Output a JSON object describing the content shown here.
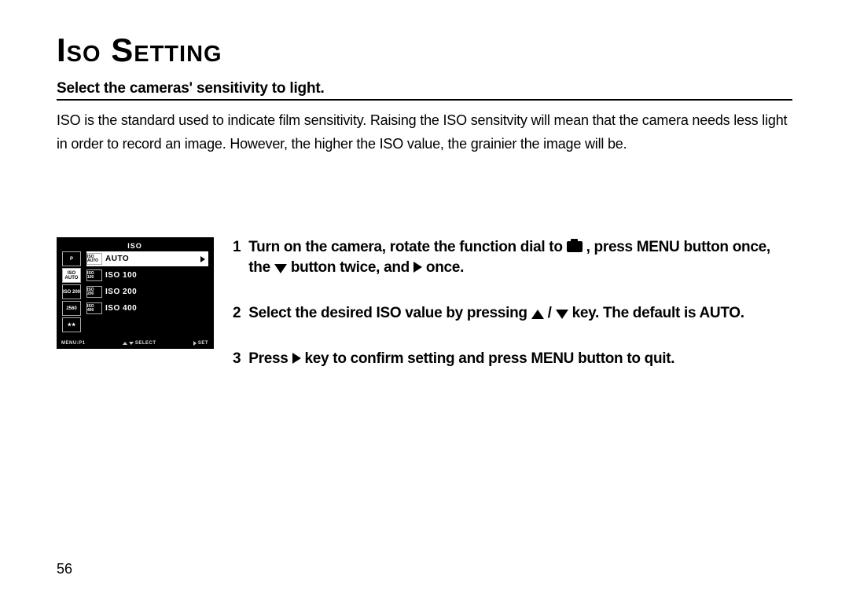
{
  "title": "Iso Setting",
  "subhead": "Select the cameras' sensitivity to light.",
  "paragraph": "ISO is the standard used to indicate film sensitivity. Raising the ISO sensitvity will mean that the camera needs less light in order to record an image. However, the higher the ISO value, the grainier the image will be.",
  "lcd": {
    "title": "ISO",
    "left_icons": [
      "P",
      "ISO\nAUTO",
      "ISO\n200",
      "2560",
      "★★"
    ],
    "rows": [
      {
        "icon": "ISO\nAUTO",
        "label": "AUTO",
        "highlight": true
      },
      {
        "icon": "ISO\n100",
        "label": "ISO 100"
      },
      {
        "icon": "ISO\n200",
        "label": "ISO 200"
      },
      {
        "icon": "ISO\n400",
        "label": "ISO 400"
      }
    ],
    "footer": {
      "left": "MENU:P1",
      "mid": "SELECT",
      "right": "SET"
    }
  },
  "steps": [
    {
      "n": "1",
      "pre": "Turn on the camera, rotate the function dial to ",
      "mid": " , press MENU button once, the  ",
      "post": " button twice, and ",
      "end": " once."
    },
    {
      "n": "2",
      "pre": "Select the desired ISO value by pressing ",
      "mid2": " / ",
      "post": "  key. The default is AUTO."
    },
    {
      "n": "3",
      "pre": "Press  ",
      "post": "  key to confirm setting and press MENU button to quit."
    }
  ],
  "page_number": "56"
}
